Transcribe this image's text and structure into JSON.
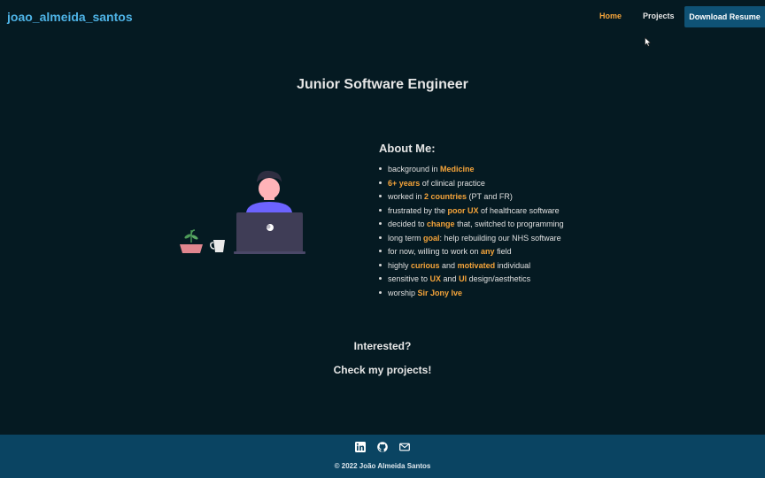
{
  "nav": {
    "brand": "joao_almeida_santos",
    "links": [
      {
        "label": "Home",
        "active": true
      },
      {
        "label": "Projects",
        "active": false
      }
    ],
    "resume_button": "Download Resume"
  },
  "hero": {
    "title": "Junior Software Engineer"
  },
  "about": {
    "heading": "About Me:",
    "items": [
      [
        {
          "t": "background in "
        },
        {
          "t": "Medicine",
          "hl": true
        }
      ],
      [
        {
          "t": "6+ years",
          "hl": true
        },
        {
          "t": " of clinical practice"
        }
      ],
      [
        {
          "t": "worked in "
        },
        {
          "t": "2 countries",
          "hl": true
        },
        {
          "t": " (PT and FR)"
        }
      ],
      [
        {
          "t": "frustrated by the "
        },
        {
          "t": "poor UX",
          "hl": true
        },
        {
          "t": " of healthcare software"
        }
      ],
      [
        {
          "t": "decided to "
        },
        {
          "t": "change",
          "hl": true
        },
        {
          "t": " that, switched to programming"
        }
      ],
      [
        {
          "t": "long term "
        },
        {
          "t": "goal",
          "hl": true
        },
        {
          "t": ": help rebuilding our NHS software"
        }
      ],
      [
        {
          "t": "for now, willing to work on "
        },
        {
          "t": "any",
          "hl": true
        },
        {
          "t": " field"
        }
      ],
      [
        {
          "t": "highly "
        },
        {
          "t": "curious",
          "hl": true
        },
        {
          "t": " and "
        },
        {
          "t": "motivated",
          "hl": true
        },
        {
          "t": " individual"
        }
      ],
      [
        {
          "t": "sensitive to "
        },
        {
          "t": "UX",
          "hl": true
        },
        {
          "t": " and "
        },
        {
          "t": "UI",
          "hl": true
        },
        {
          "t": " design/aesthetics"
        }
      ],
      [
        {
          "t": "worship "
        },
        {
          "t": "Sir Jony Ive",
          "hl": true
        }
      ]
    ]
  },
  "cta": {
    "interested": "Interested?",
    "check": "Check my projects!"
  },
  "footer": {
    "icons": [
      "linkedin-icon",
      "github-icon",
      "email-icon"
    ],
    "copyright": "© 2022 João Almeida Santos"
  },
  "colors": {
    "background": "#051a22",
    "accent": "#f5a43a",
    "brand": "#4eb3e6",
    "button": "#0f5275",
    "footer": "#0a4462"
  }
}
